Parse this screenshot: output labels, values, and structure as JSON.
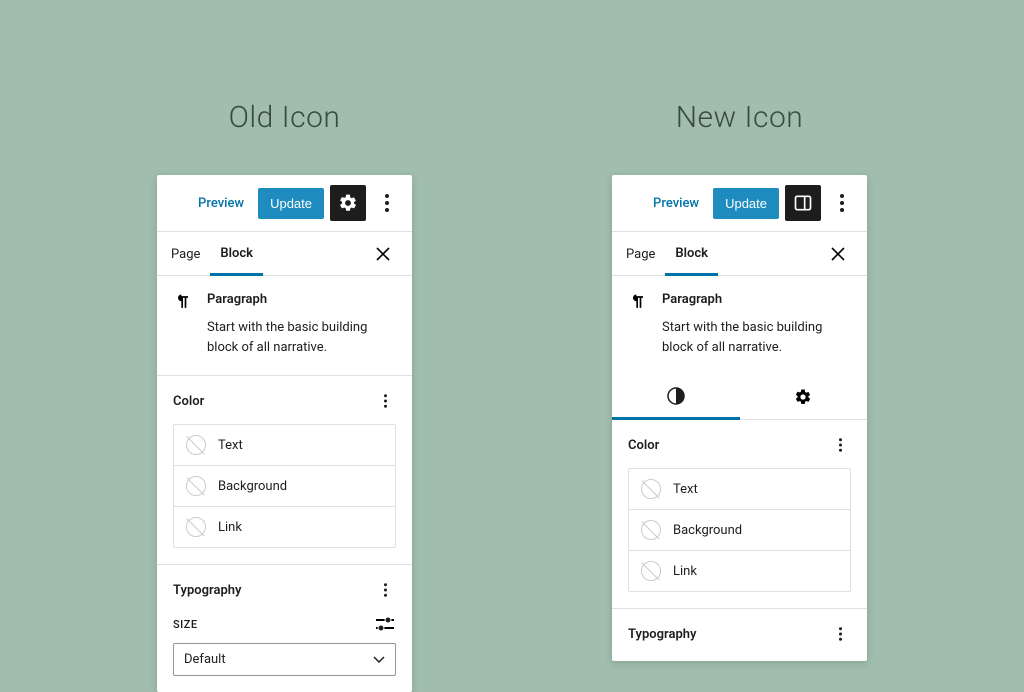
{
  "columns": {
    "old": {
      "heading": "Old Icon"
    },
    "new": {
      "heading": "New Icon"
    }
  },
  "toolbar": {
    "preview_label": "Preview",
    "update_label": "Update"
  },
  "tabs": {
    "page": "Page",
    "block": "Block"
  },
  "block_info": {
    "title": "Paragraph",
    "description": "Start with the basic building block of all narrative."
  },
  "sections": {
    "color": {
      "title": "Color",
      "items": [
        "Text",
        "Background",
        "Link"
      ]
    },
    "typography": {
      "title": "Typography",
      "size_label": "SIZE",
      "size_select": "Default"
    }
  }
}
